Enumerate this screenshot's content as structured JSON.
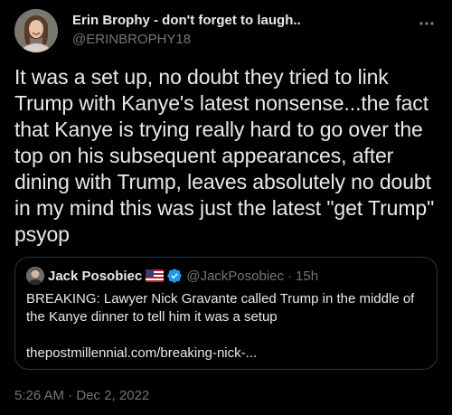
{
  "tweet": {
    "author": {
      "display_name": "Erin Brophy - don't forget to laugh..",
      "handle": "@ERINBROPHY18",
      "avatar": "avatar-photo"
    },
    "more_icon": "more-options-icon",
    "text": "It was a set up, no doubt they tried to link Trump with Kanye's latest nonsense...the fact that Kanye is trying really hard to go over the top on his subsequent appearances, after dining with Trump, leaves absolutely no doubt in my mind this was just the latest \"get Trump\" psyop",
    "timestamp": "5:26 AM · Dec 2, 2022"
  },
  "quote": {
    "author": {
      "display_name": "Jack Posobiec",
      "flag": "us-flag-icon",
      "verified": "verified-badge-icon",
      "handle": "@JackPosobiec",
      "separator": "·",
      "time": "15h"
    },
    "text": "BREAKING: Lawyer Nick Gravante called Trump in the middle of the Kanye dinner to tell him it was a setup",
    "link": "thepostmillennial.com/breaking-nick-..."
  },
  "colors": {
    "background": "#000000",
    "primary_text": "#e7e9ea",
    "secondary_text": "#71767b",
    "border": "#2f3336",
    "verified": "#1d9bf0"
  }
}
